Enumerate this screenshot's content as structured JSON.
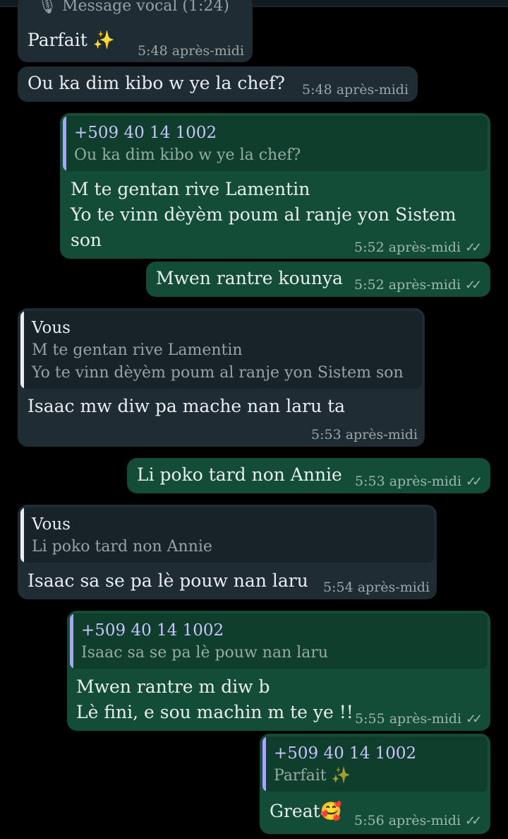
{
  "colors": {
    "incoming": "#1f2c33",
    "outgoing": "#134d37",
    "background": "#000000",
    "quote_accent": "#a9a3ff"
  },
  "messages": [
    {
      "id": "m0",
      "direction": "in",
      "voice_label": "Message vocal (1:24)",
      "text": "Parfait ✨",
      "time": "5:48 après-midi"
    },
    {
      "id": "m1",
      "direction": "in",
      "text": "Ou ka dim kibo w ye la chef?",
      "time": "5:48 après-midi"
    },
    {
      "id": "m2",
      "direction": "out",
      "quote_author": "+509 40 14 1002",
      "quote_text": "Ou ka dim kibo w ye la chef?",
      "text": "M te gentan rive Lamentin\nYo te vinn dèyèm poum al ranje yon Sistem\nson",
      "time": "5:52 après-midi",
      "read": true
    },
    {
      "id": "m3",
      "direction": "out",
      "text": "Mwen rantre kounya",
      "time": "5:52 après-midi",
      "read": true
    },
    {
      "id": "m4",
      "direction": "in",
      "quote_author": "Vous",
      "quote_text": "M te gentan rive Lamentin\nYo te vinn dèyèm poum al ranje yon Sistem son",
      "text": "Isaac mw diw pa mache nan laru ta",
      "time": "5:53 après-midi"
    },
    {
      "id": "m5",
      "direction": "out",
      "text": "Li poko tard non Annie",
      "time": "5:53 après-midi",
      "read": true
    },
    {
      "id": "m6",
      "direction": "in",
      "quote_author": "Vous",
      "quote_text": "Li poko tard non Annie",
      "text": "Isaac sa se pa lè pouw nan laru",
      "time": "5:54 après-midi"
    },
    {
      "id": "m7",
      "direction": "out",
      "quote_author": "+509 40 14 1002",
      "quote_text": "Isaac sa se pa lè pouw nan laru",
      "text": "Mwen rantre m diw b\nLè fini, e sou machin m te ye !!",
      "time": "5:55 après-midi",
      "read": true
    },
    {
      "id": "m8",
      "direction": "out",
      "quote_author": "+509 40 14 1002",
      "quote_text": "Parfait ✨",
      "text": "Great🥰",
      "time": "5:56 après-midi",
      "read": true
    }
  ]
}
